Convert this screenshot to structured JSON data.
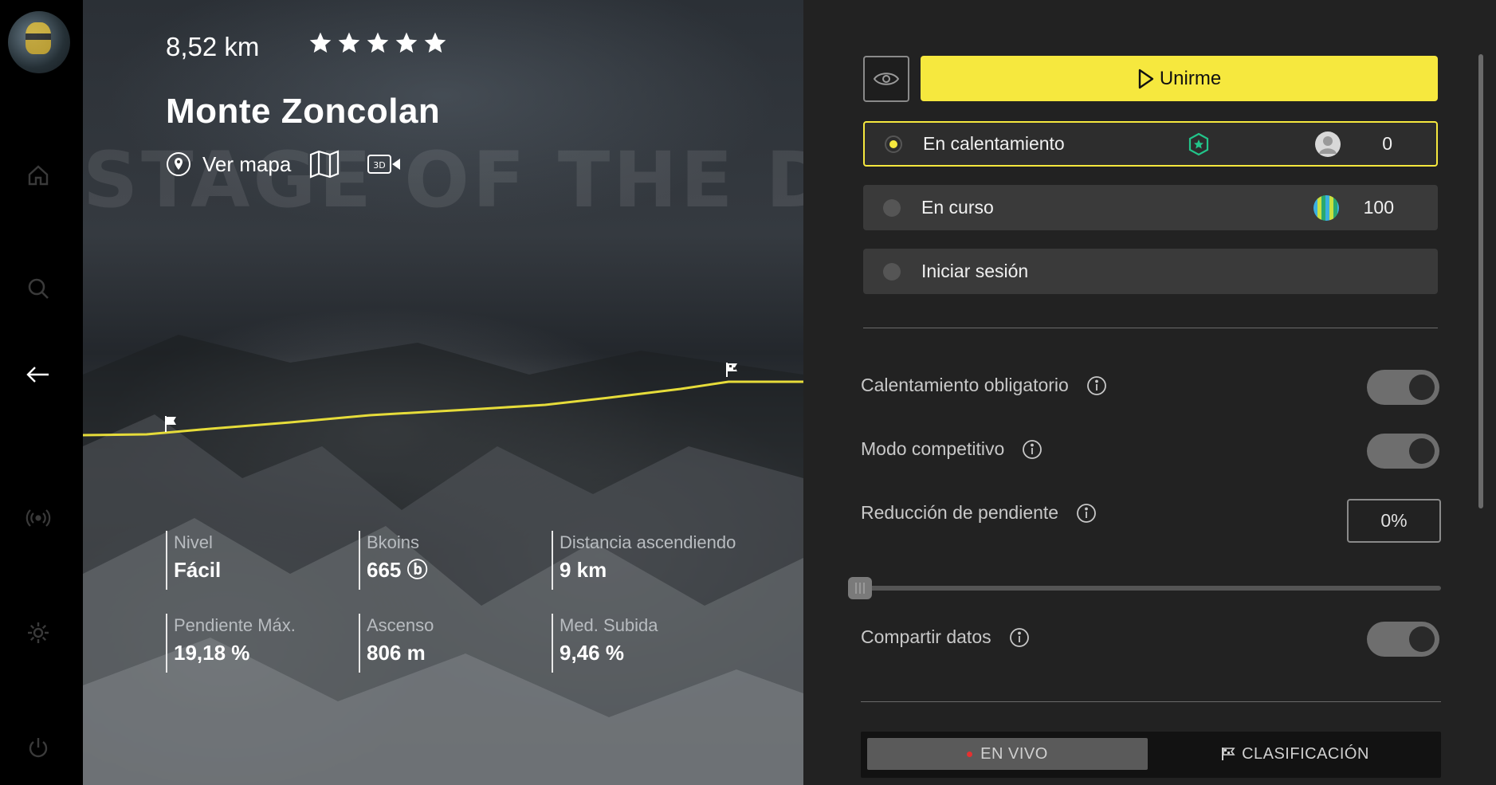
{
  "sidebar": {
    "items": [
      {
        "name": "home",
        "icon": "home-icon"
      },
      {
        "name": "search",
        "icon": "search-icon"
      },
      {
        "name": "back",
        "icon": "arrow-left-icon"
      },
      {
        "name": "broadcast",
        "icon": "broadcast-icon"
      },
      {
        "name": "settings",
        "icon": "gear-icon"
      },
      {
        "name": "power",
        "icon": "power-icon"
      }
    ]
  },
  "route": {
    "distance": "8,52 km",
    "rating": 5,
    "title": "Monte Zoncolan",
    "view_map_label": "Ver mapa",
    "watermark": "STAGE OF THE DAY",
    "stats": [
      {
        "label": "Nivel",
        "value": "Fácil"
      },
      {
        "label": "Bkoins",
        "value": "665 ⓑ"
      },
      {
        "label": "Distancia ascendiendo",
        "value": "9 km"
      },
      {
        "label": "Pendiente Máx.",
        "value": "19,18 %"
      },
      {
        "label": "Ascenso",
        "value": "806 m"
      },
      {
        "label": "Med. Subida",
        "value": "9,46 %"
      }
    ]
  },
  "panel": {
    "join_label": "Unirme",
    "options": [
      {
        "label": "En calentamiento",
        "count": "0",
        "selected": true
      },
      {
        "label": "En curso",
        "count": "100",
        "selected": false
      },
      {
        "label": "Iniciar sesión",
        "count": "",
        "selected": false
      }
    ],
    "settings": {
      "warmup_label": "Calentamiento obligatorio",
      "competitive_label": "Modo competitivo",
      "slope_label": "Reducción de pendiente",
      "slope_value": "0%",
      "slope_fraction": 0,
      "share_label": "Compartir datos"
    },
    "tabs": {
      "live": "EN VIVO",
      "ranking": "CLASIFICACIÓN"
    }
  },
  "colors": {
    "accent": "#f6e83e",
    "panel_bg": "#222222",
    "live_dot": "#e53030",
    "badge": "#22c58a"
  }
}
